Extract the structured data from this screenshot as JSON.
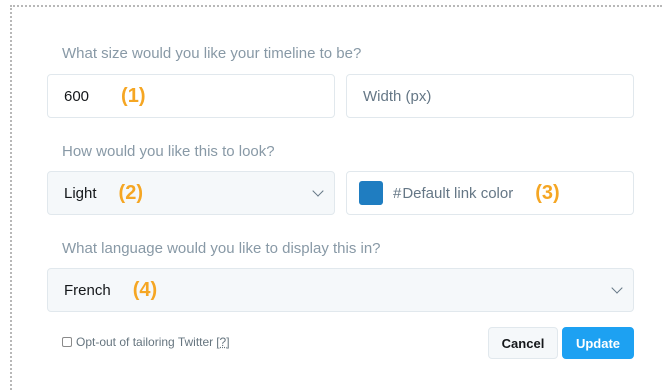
{
  "size_section": {
    "question": "What size would you like your timeline to be?",
    "value_input": "600",
    "value_annotation": "(1)",
    "width_placeholder": "Width (px)"
  },
  "look_section": {
    "question": "How would you like this to look?",
    "theme_selected": "Light",
    "theme_annotation": "(2)",
    "link_color_hash": "#",
    "link_color_placeholder": "Default link color",
    "link_color_annotation": "(3)",
    "link_color_swatch": "#1f7dc1"
  },
  "language_section": {
    "question": "What language would you like to display this in?",
    "language_selected": "French",
    "language_annotation": "(4)"
  },
  "footer": {
    "optout_label": "Opt-out of tailoring Twitter",
    "help_link": "[?]",
    "cancel_label": "Cancel",
    "update_label": "Update"
  },
  "colors": {
    "accent": "#1da1f2",
    "annotation": "#f5a623"
  }
}
